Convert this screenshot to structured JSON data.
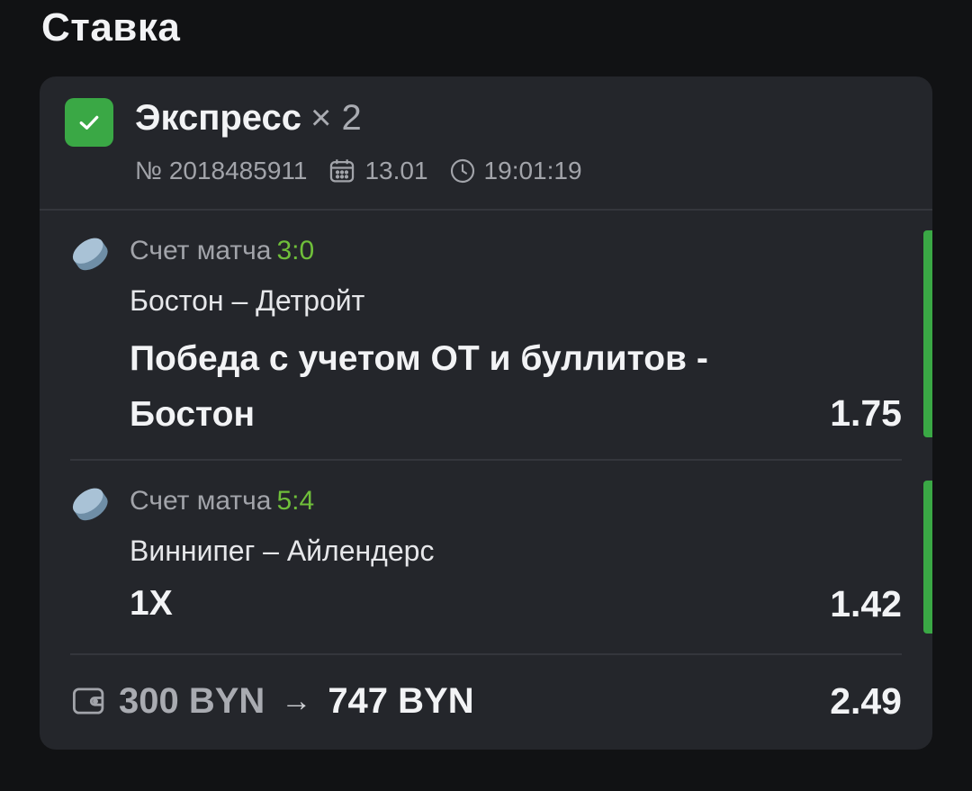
{
  "page": {
    "title": "Ставка"
  },
  "bet": {
    "type": "Экспресс",
    "multiplier": "× 2",
    "number": "№ 2018485911",
    "date": "13.01",
    "time": "19:01:19",
    "status_color": "#3aa845"
  },
  "events": [
    {
      "sport_icon": "hockey-puck-icon",
      "label": "Счет матча",
      "score": "3:0",
      "teams": "Бостон – Детройт",
      "market": "Победа с учетом ОТ и буллитов - Бостон",
      "odds": "1.75",
      "status": "won"
    },
    {
      "sport_icon": "hockey-puck-icon",
      "label": "Счет матча",
      "score": "5:4",
      "teams": "Виннипег – Айлендерс",
      "market": "1Х",
      "odds": "1.42",
      "status": "won"
    }
  ],
  "footer": {
    "stake": "300 BYN",
    "arrow": "→",
    "payout": "747 BYN",
    "total_odds": "2.49"
  },
  "colors": {
    "background": "#111214",
    "card": "#24262b",
    "accent_green": "#3aa845",
    "score_green": "#6fbf3a"
  }
}
